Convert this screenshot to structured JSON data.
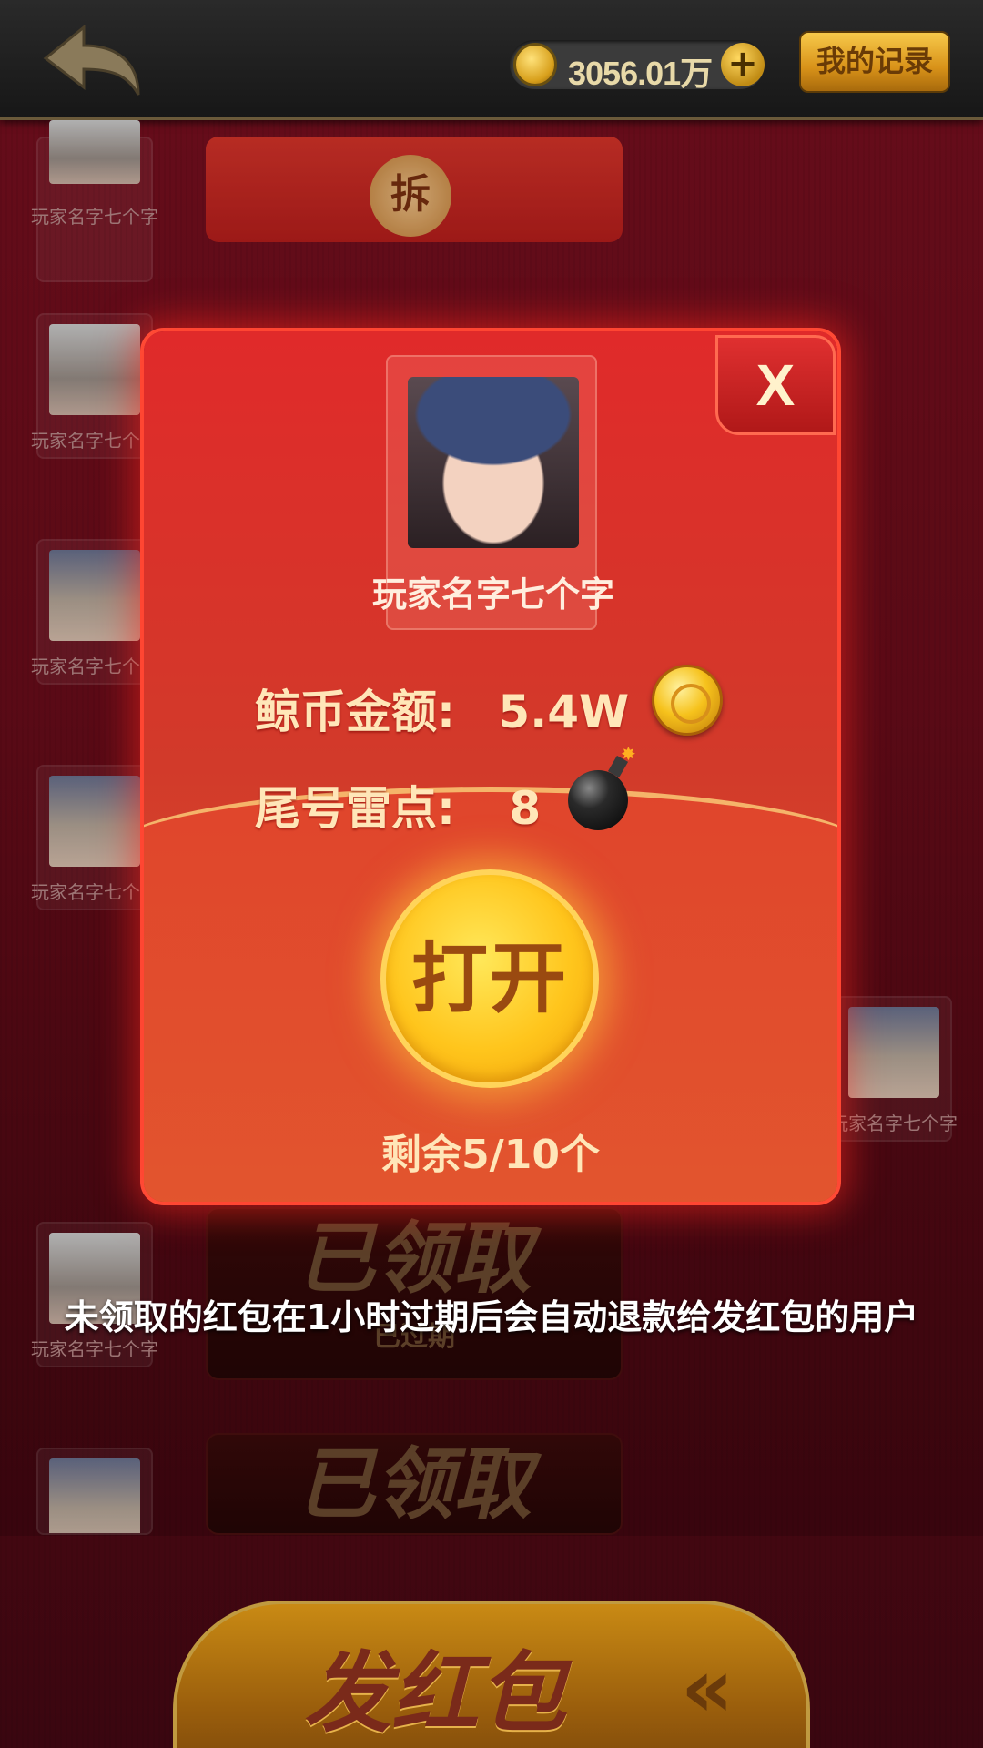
{
  "header": {
    "coin_balance": "3056.01万",
    "records_label": "我的记录",
    "plus_label": "+"
  },
  "list": {
    "open_label": "拆",
    "player_name": "玩家名字七个字",
    "claimed_label": "已领取",
    "expired_label": "已过期"
  },
  "modal": {
    "close_label": "X",
    "sender_name": "玩家名字七个字",
    "amount_label": "鲸币金额:",
    "amount_value": "5.4W",
    "mine_label": "尾号雷点:",
    "mine_value": "8",
    "open_label": "打开",
    "remaining": "剩余5/10个"
  },
  "notice": "未领取的红包在1小时过期后会自动退款给发红包的用户",
  "send_button_label": "发红包",
  "colors": {
    "accent_red": "#e02a2a",
    "gold": "#ffc51c",
    "text_cream": "#ffe6b8"
  }
}
